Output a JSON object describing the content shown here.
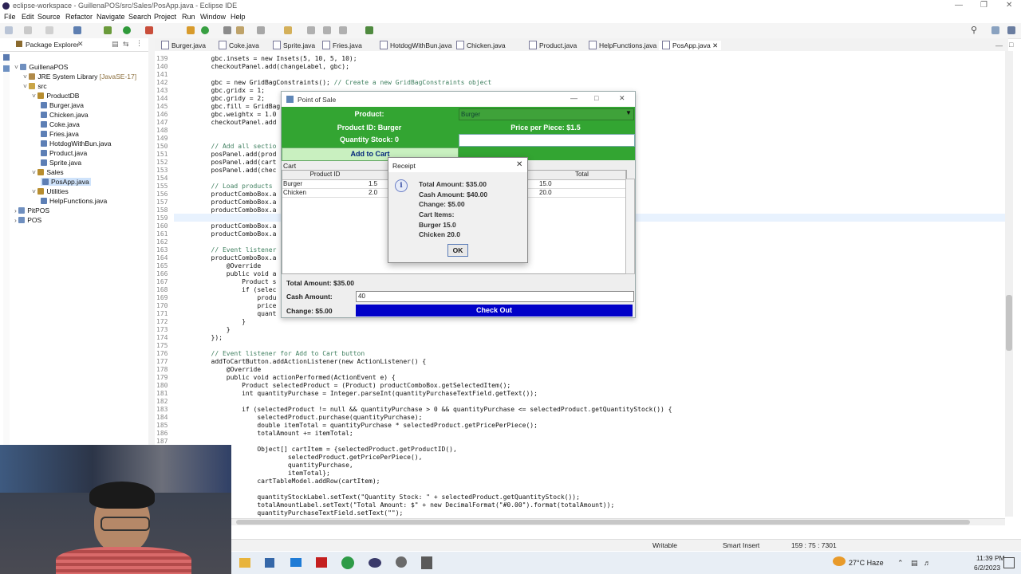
{
  "window": {
    "title": "eclipse-workspace - GuillenaPOS/src/Sales/PosApp.java - Eclipse IDE"
  },
  "menubar": {
    "items": [
      "File",
      "Edit",
      "Source",
      "Refactor",
      "Navigate",
      "Search",
      "Project",
      "Run",
      "Window",
      "Help"
    ]
  },
  "package_explorer": {
    "tab_label": "Package Explorer",
    "tree": [
      {
        "label": "GuillenaPOS",
        "depth": 0,
        "icon": "project-icon"
      },
      {
        "label": "JRE System Library",
        "suffix": "[JavaSE-17]",
        "depth": 1,
        "icon": "library-icon"
      },
      {
        "label": "src",
        "depth": 1,
        "icon": "folder-icon"
      },
      {
        "label": "ProductDB",
        "depth": 2,
        "icon": "package-icon"
      },
      {
        "label": "Burger.java",
        "depth": 3,
        "icon": "java-file-icon"
      },
      {
        "label": "Chicken.java",
        "depth": 3,
        "icon": "java-file-icon"
      },
      {
        "label": "Coke.java",
        "depth": 3,
        "icon": "java-file-icon"
      },
      {
        "label": "Fries.java",
        "depth": 3,
        "icon": "java-file-icon"
      },
      {
        "label": "HotdogWithBun.java",
        "depth": 3,
        "icon": "java-file-icon"
      },
      {
        "label": "Product.java",
        "depth": 3,
        "icon": "java-file-icon"
      },
      {
        "label": "Sprite.java",
        "depth": 3,
        "icon": "java-file-icon"
      },
      {
        "label": "Sales",
        "depth": 2,
        "icon": "package-icon"
      },
      {
        "label": "PosApp.java",
        "depth": 3,
        "icon": "java-file-icon",
        "selected": true
      },
      {
        "label": "Utilities",
        "depth": 2,
        "icon": "package-icon"
      },
      {
        "label": "HelpFunctions.java",
        "depth": 3,
        "icon": "java-file-icon"
      },
      {
        "label": "PitPOS",
        "depth": 0,
        "icon": "project-icon"
      },
      {
        "label": "POS",
        "depth": 0,
        "icon": "project-icon"
      }
    ]
  },
  "editor_tabs": [
    "Burger.java",
    "Coke.java",
    "Sprite.java",
    "Fries.java",
    "HotdogWithBun.java",
    "Chicken.java",
    "Product.java",
    "HelpFunctions.java",
    "PosApp.java"
  ],
  "editor": {
    "lines": [
      {
        "n": "139",
        "t": "        gbc.insets = new Insets(5, 10, 5, 10);"
      },
      {
        "n": "140",
        "t": "        checkoutPanel.add(changeLabel, gbc);"
      },
      {
        "n": "141",
        "t": ""
      },
      {
        "n": "142",
        "t": "        gbc = new GridBagConstraints(); // Create a new GridBagConstraints object"
      },
      {
        "n": "143",
        "t": "        gbc.gridx = 1;"
      },
      {
        "n": "144",
        "t": "        gbc.gridy = 2;"
      },
      {
        "n": "145",
        "t": "        gbc.fill = GridBag"
      },
      {
        "n": "146",
        "t": "        gbc.weightx = 1.0"
      },
      {
        "n": "147",
        "t": "        checkoutPanel.add"
      },
      {
        "n": "148",
        "t": ""
      },
      {
        "n": "149",
        "t": ""
      },
      {
        "n": "150",
        "t": "        // Add all sectio"
      },
      {
        "n": "151",
        "t": "        posPanel.add(prod"
      },
      {
        "n": "152",
        "t": "        posPanel.add(cart"
      },
      {
        "n": "153",
        "t": "        posPanel.add(chec"
      },
      {
        "n": "154",
        "t": ""
      },
      {
        "n": "155",
        "t": "        // Load products"
      },
      {
        "n": "156",
        "t": "        productComboBox.a"
      },
      {
        "n": "157",
        "t": "        productComboBox.a"
      },
      {
        "n": "158",
        "t": "        productComboBox.a"
      },
      {
        "n": "159",
        "t": "        productComboBox.a"
      },
      {
        "n": "160",
        "t": "        productComboBox.a"
      },
      {
        "n": "161",
        "t": "        productComboBox.a"
      },
      {
        "n": "162",
        "t": ""
      },
      {
        "n": "163",
        "t": "        // Event listener"
      },
      {
        "n": "164",
        "t": "        productComboBox.a"
      },
      {
        "n": "165",
        "t": "            @Override"
      },
      {
        "n": "166",
        "t": "            public void a"
      },
      {
        "n": "167",
        "t": "                Product s"
      },
      {
        "n": "168",
        "t": "                if (selec"
      },
      {
        "n": "169",
        "t": "                    produ"
      },
      {
        "n": "170",
        "t": "                    price"
      },
      {
        "n": "171",
        "t": "                    quant"
      },
      {
        "n": "172",
        "t": "                }"
      },
      {
        "n": "173",
        "t": "            }"
      },
      {
        "n": "174",
        "t": "        });"
      },
      {
        "n": "175",
        "t": ""
      },
      {
        "n": "176",
        "t": "        // Event listener for Add to Cart button"
      },
      {
        "n": "177",
        "t": "        addToCartButton.addActionListener(new ActionListener() {"
      },
      {
        "n": "178",
        "t": "            @Override"
      },
      {
        "n": "179",
        "t": "            public void actionPerformed(ActionEvent e) {"
      },
      {
        "n": "180",
        "t": "                Product selectedProduct = (Product) productComboBox.getSelectedItem();"
      },
      {
        "n": "181",
        "t": "                int quantityPurchase = Integer.parseInt(quantityPurchaseTextField.getText());"
      },
      {
        "n": "182",
        "t": ""
      },
      {
        "n": "183",
        "t": "                if (selectedProduct != null && quantityPurchase > 0 && quantityPurchase <= selectedProduct.getQuantityStock()) {"
      },
      {
        "n": "184",
        "t": "                    selectedProduct.purchase(quantityPurchase);"
      },
      {
        "n": "185",
        "t": "                    double itemTotal = quantityPurchase * selectedProduct.getPricePerPiece();"
      },
      {
        "n": "186",
        "t": "                    totalAmount += itemTotal;"
      },
      {
        "n": "187",
        "t": ""
      },
      {
        "n": "188",
        "t": "                    Object[] cartItem = {selectedProduct.getProductID(),"
      },
      {
        "n": "189",
        "t": "                            selectedProduct.getPricePerPiece(),"
      },
      {
        "n": "190",
        "t": "                            quantityPurchase,"
      },
      {
        "n": "191",
        "t": "                            itemTotal};"
      },
      {
        "n": "192",
        "t": "                    cartTableModel.addRow(cartItem);"
      },
      {
        "n": "193",
        "t": ""
      },
      {
        "n": "194",
        "t": "                    quantityStockLabel.setText(\"Quantity Stock: \" + selectedProduct.getQuantityStock());"
      },
      {
        "n": "195",
        "t": "                    totalAmountLabel.setText(\"Total Amount: $\" + new DecimalFormat(\"#0.00\").format(totalAmount));"
      },
      {
        "n": "196",
        "t": "                    quantityPurchaseTextField.setText(\"\");"
      }
    ]
  },
  "pos_window": {
    "title": "Point of Sale",
    "product_label": "Product:",
    "product_selected": "Burger",
    "product_id": "Product ID: Burger",
    "price_per_piece": "Price per Piece: $1.5",
    "quantity_stock": "Quantity Stock: 0",
    "add_to_cart": "Add to Cart",
    "cart_label": "Cart",
    "columns": [
      "Product ID",
      "",
      "",
      "Total"
    ],
    "rows": [
      [
        "Burger",
        "1.5",
        "",
        "15.0"
      ],
      [
        "Chicken",
        "2.0",
        "",
        "20.0"
      ]
    ],
    "total_amount": "Total Amount: $35.00",
    "cash_label": "Cash Amount:",
    "cash_value": "40",
    "change": "Change: $5.00",
    "checkout": "Check Out",
    "colors": {
      "green": "#33a532",
      "blue": "#0000c8"
    }
  },
  "receipt": {
    "title": "Receipt",
    "lines": [
      "Total Amount: $35.00",
      "Cash Amount: $40.00",
      "Change: $5.00",
      "Cart Items:",
      "Burger 15.0",
      "Chicken 20.0"
    ],
    "ok": "OK"
  },
  "statusbar": {
    "writable": "Writable",
    "insert": "Smart Insert",
    "position": "159 : 75 : 7301"
  },
  "taskbar": {
    "weather": "27°C  Haze",
    "time": "11:39 PM",
    "date": "6/2/2023"
  }
}
